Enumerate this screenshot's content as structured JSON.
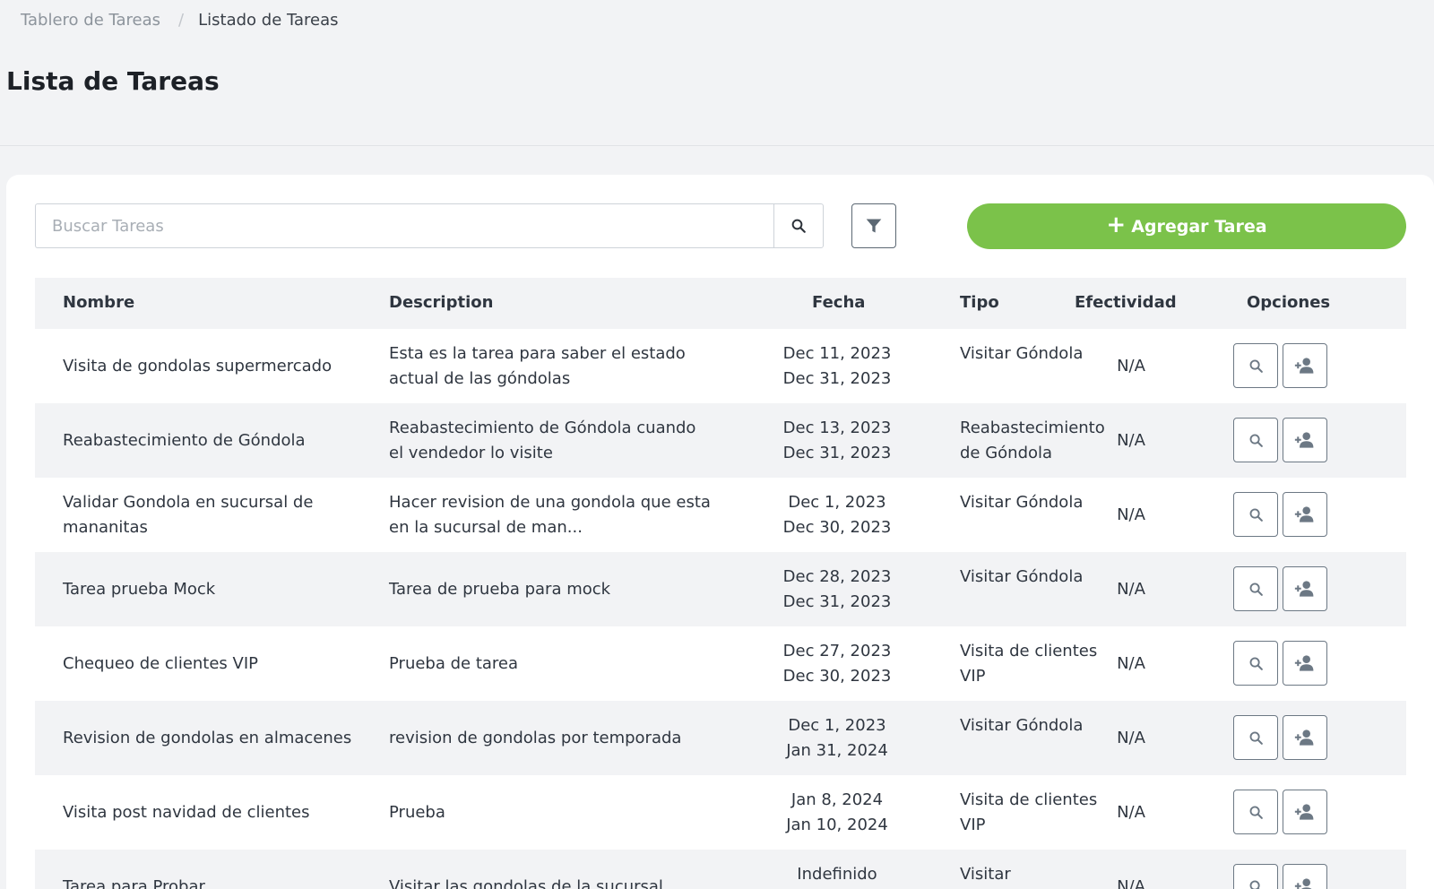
{
  "breadcrumb": {
    "parent": "Tablero de Tareas",
    "separator": "/",
    "current": "Listado de Tareas"
  },
  "page_title": "Lista de Tareas",
  "toolbar": {
    "search_placeholder": "Buscar Tareas",
    "search_value": "",
    "add_label": "Agregar Tarea",
    "add_icon": "plus-icon",
    "filter_icon": "filter-icon",
    "search_icon": "search-icon"
  },
  "colors": {
    "accent": "#7bc24a",
    "row_alt": "#f2f3f5",
    "text": "#2f3640"
  },
  "table": {
    "headers": {
      "nombre": "Nombre",
      "description": "Description",
      "fecha": "Fecha",
      "tipo": "Tipo",
      "efectividad": "Efectividad",
      "opciones": "Opciones"
    },
    "rows": [
      {
        "nombre": "Visita de gondolas supermercado",
        "description": "Esta es la tarea para saber el estado actual de las góndolas",
        "fecha_inicio": "Dec 11, 2023",
        "fecha_fin": "Dec 31, 2023",
        "tipo": "Visitar Góndola",
        "efectividad": "N/A"
      },
      {
        "nombre": "Reabastecimiento de Góndola",
        "description": "Reabastecimiento de Góndola cuando el vendedor lo visite",
        "fecha_inicio": "Dec 13, 2023",
        "fecha_fin": "Dec 31, 2023",
        "tipo": "Reabastecimiento de Góndola",
        "efectividad": "N/A"
      },
      {
        "nombre": "Validar Gondola en sucursal de mananitas",
        "description": "Hacer revision de una gondola que esta en la sucursal de man...",
        "fecha_inicio": "Dec 1, 2023",
        "fecha_fin": "Dec 30, 2023",
        "tipo": "Visitar Góndola",
        "efectividad": "N/A"
      },
      {
        "nombre": "Tarea prueba Mock",
        "description": "Tarea de prueba para mock",
        "fecha_inicio": "Dec 28, 2023",
        "fecha_fin": "Dec 31, 2023",
        "tipo": "Visitar Góndola",
        "efectividad": "N/A"
      },
      {
        "nombre": "Chequeo de clientes VIP",
        "description": "Prueba de tarea",
        "fecha_inicio": "Dec 27, 2023",
        "fecha_fin": "Dec 30, 2023",
        "tipo": "Visita de clientes VIP",
        "efectividad": "N/A"
      },
      {
        "nombre": "Revision de gondolas en almacenes",
        "description": "revision de gondolas por temporada",
        "fecha_inicio": "Dec 1, 2023",
        "fecha_fin": "Jan 31, 2024",
        "tipo": "Visitar Góndola",
        "efectividad": "N/A"
      },
      {
        "nombre": "Visita post navidad de clientes",
        "description": "Prueba",
        "fecha_inicio": "Jan 8, 2024",
        "fecha_fin": "Jan 10, 2024",
        "tipo": "Visita de clientes VIP",
        "efectividad": "N/A"
      },
      {
        "nombre": "Tarea para Probar",
        "description": "Visitar las gondolas de la sucursal",
        "fecha_inicio": "Indefinido",
        "fecha_fin": "",
        "tipo": "Visitar",
        "efectividad": "N/A"
      }
    ],
    "row_actions": {
      "view_icon": "search-icon",
      "assign_icon": "add-user-icon"
    }
  }
}
